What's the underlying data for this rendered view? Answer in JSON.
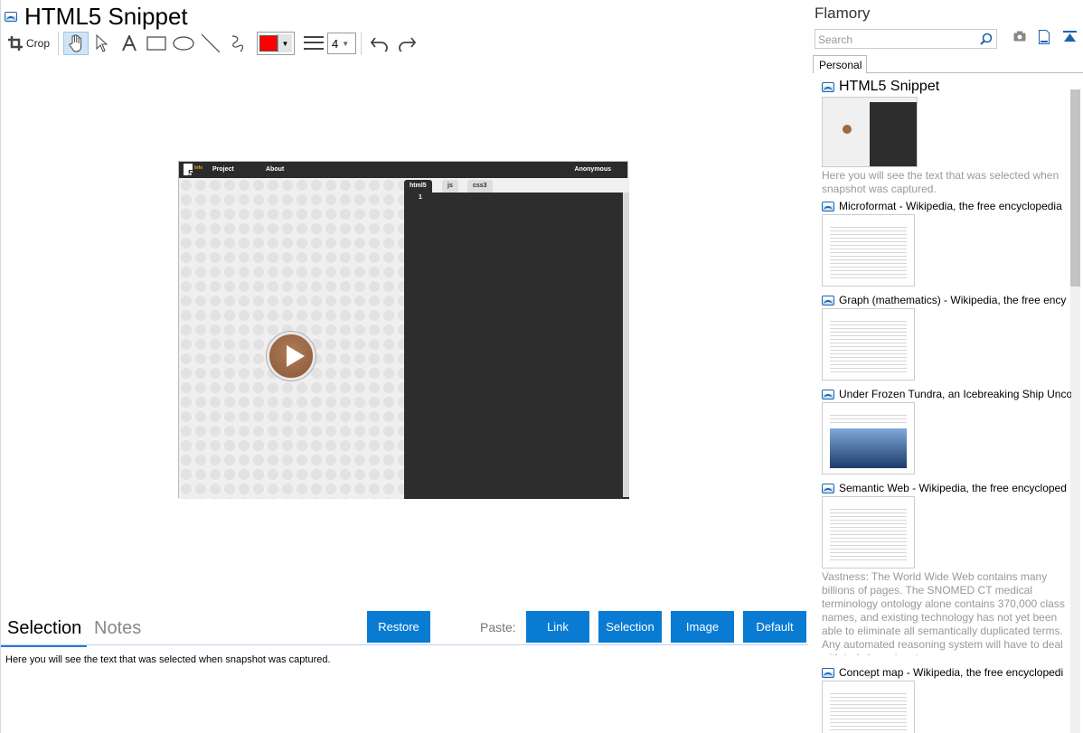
{
  "window": {
    "title": "HTML5 Snippet"
  },
  "toolbar": {
    "crop_label": "Crop",
    "line_width": "4",
    "color": "#ff0000",
    "tools": [
      "hand-icon",
      "pointer-icon",
      "text-icon",
      "rectangle-icon",
      "ellipse-icon",
      "line-icon",
      "freehand-icon",
      "undo-icon",
      "redo-icon"
    ]
  },
  "snapshot": {
    "logo": "5",
    "logo_sub": "Info",
    "nav": [
      "Project",
      "About"
    ],
    "user": "Anonymous",
    "tabs": [
      "html5",
      "js",
      "css3"
    ],
    "line_number": "1"
  },
  "bottom": {
    "tab_selection": "Selection",
    "tab_notes": "Notes",
    "restore": "Restore",
    "paste_label": "Paste:",
    "paste_buttons": [
      "Link",
      "Selection",
      "Image",
      "Default"
    ],
    "selection_text": "Here you will see the text that was selected when snapshot was captured."
  },
  "sidebar": {
    "title": "Flamory",
    "search_placeholder": "Search",
    "tab": "Personal",
    "items": [
      {
        "title": "HTML5 Snippet",
        "desc": "Here you will see the text that was selected when snapshot was captured."
      },
      {
        "title": "Microformat - Wikipedia, the free encyclopedia",
        "desc": ""
      },
      {
        "title": "Graph (mathematics) - Wikipedia, the free ency",
        "desc": ""
      },
      {
        "title": "Under Frozen Tundra, an Icebreaking Ship Unco",
        "desc": ""
      },
      {
        "title": "Semantic Web - Wikipedia, the free encycloped",
        "desc": "Vastness: The World Wide Web contains many billions of pages. The SNOMED CT medical terminology ontology alone contains 370,000 class names, and existing technology has not yet been able to eliminate all semantically duplicated terms. Any automated reasoning system will have to deal with truly huge inputs."
      },
      {
        "title": "Concept map - Wikipedia, the free encyclopedi",
        "desc": ""
      }
    ]
  }
}
